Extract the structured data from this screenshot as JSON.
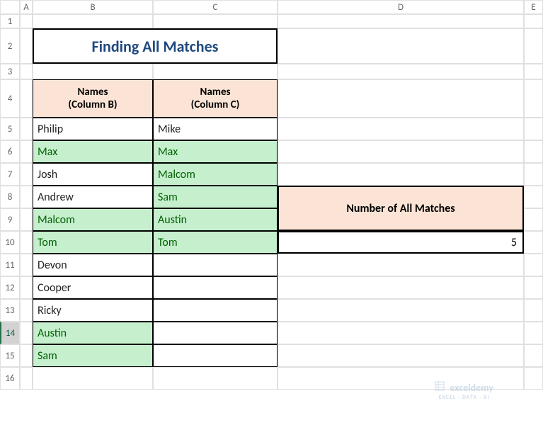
{
  "columns": [
    "A",
    "B",
    "C",
    "D",
    "E"
  ],
  "rows": [
    "1",
    "2",
    "3",
    "4",
    "5",
    "6",
    "7",
    "8",
    "9",
    "10",
    "11",
    "12",
    "13",
    "14",
    "15",
    "16"
  ],
  "selected_row": "14",
  "title": "Finding All Matches",
  "headers": {
    "b_line1": "Names",
    "b_line2": "(Column B)",
    "c_line1": "Names",
    "c_line2": "(Column C)"
  },
  "data_b": [
    {
      "v": "Philip",
      "m": false
    },
    {
      "v": "Max",
      "m": true
    },
    {
      "v": "Josh",
      "m": false
    },
    {
      "v": "Andrew",
      "m": false
    },
    {
      "v": "Malcom",
      "m": true
    },
    {
      "v": "Tom",
      "m": true
    },
    {
      "v": "Devon",
      "m": false
    },
    {
      "v": "Cooper",
      "m": false
    },
    {
      "v": "Ricky",
      "m": false
    },
    {
      "v": "Austin",
      "m": true
    },
    {
      "v": "Sam",
      "m": true
    }
  ],
  "data_c": [
    {
      "v": "Mike",
      "m": false
    },
    {
      "v": "Max",
      "m": true
    },
    {
      "v": "Malcom",
      "m": true
    },
    {
      "v": "Sam",
      "m": true
    },
    {
      "v": "Austin",
      "m": true
    },
    {
      "v": "Tom",
      "m": true
    },
    {
      "v": "",
      "m": false
    },
    {
      "v": "",
      "m": false
    },
    {
      "v": "",
      "m": false
    },
    {
      "v": "",
      "m": false
    },
    {
      "v": "",
      "m": false
    }
  ],
  "matches": {
    "label": "Number of All Matches",
    "value": "5"
  },
  "watermark": {
    "text": "exceldemy",
    "sub": "EXCEL · DATA · BI"
  }
}
